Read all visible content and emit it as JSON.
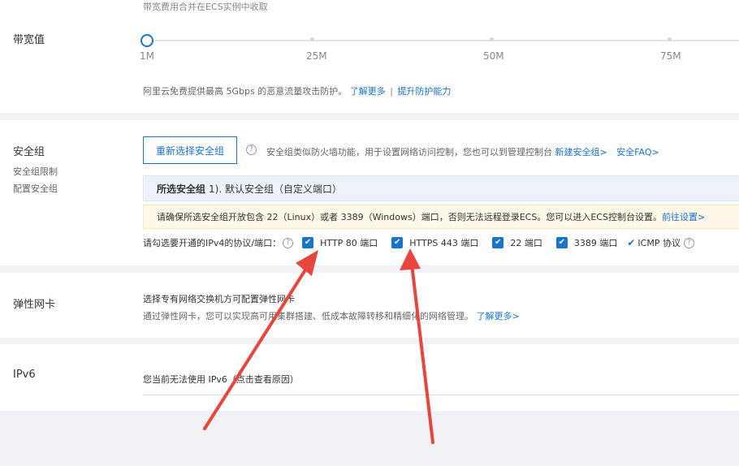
{
  "bandwidth": {
    "note": "带宽费用合并在ECS实例中收取",
    "label": "带宽值",
    "ticks": [
      "1M",
      "25M",
      "50M",
      "75M"
    ],
    "ddos_text": "阿里云免费提供最高 5Gbps 的恶意流量攻击防护。",
    "learn_more": "了解更多",
    "separator": "|",
    "improve": "提升防护能力"
  },
  "security_group": {
    "label": "安全组",
    "sublabel1": "安全组限制",
    "sublabel2": "配置安全组",
    "reselect_button": "重新选择安全组",
    "help_glyph": "?",
    "desc": "安全组类似防火墙功能，用于设置网络访问控制，您也可以到管理控制台",
    "create_link": "新建安全组>",
    "faq_link": "安全FAQ>",
    "selected_title": "所选安全组",
    "selected_value": "1). 默认安全组（自定义端口）",
    "warning": "请确保所选安全组开放包含 22（Linux）或者 3389（Windows）端口，否则无法远程登录ECS。您可以进入ECS控制台设置。",
    "warning_link": "前往设置>",
    "ports_prompt": "请勾选要开通的IPv4的协议/端口：",
    "ports": [
      {
        "label": "HTTP 80 端口"
      },
      {
        "label": "HTTPS 443 端口"
      },
      {
        "label": "22 端口"
      },
      {
        "label": "3389 端口"
      }
    ],
    "check_glyph": "✔",
    "icmp_label": "ICMP 协议"
  },
  "eni": {
    "label": "弹性网卡",
    "title": "选择专有网络交换机方可配置弹性网卡",
    "desc": "通过弹性网卡，您可以实现高可用集群搭建、低成本故障转移和精细化的网络管理。",
    "learn_more": "了解更多>"
  },
  "ipv6": {
    "label": "IPv6",
    "note": "您当前无法使用 IPv6（点击查看原因）"
  },
  "colors": {
    "primary": "#1a74c9",
    "arrow": "#e8453c"
  }
}
